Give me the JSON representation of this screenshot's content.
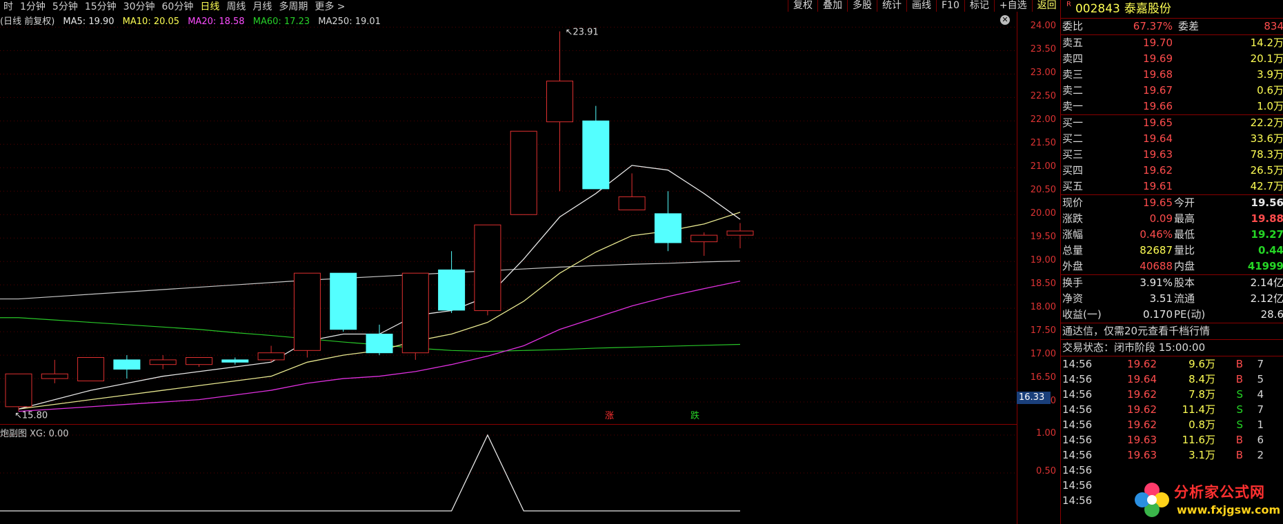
{
  "periods": [
    "时",
    "1分钟",
    "5分钟",
    "15分钟",
    "30分钟",
    "60分钟",
    "日线",
    "周线",
    "月线",
    "多周期",
    "更多 >"
  ],
  "active_period": "日线",
  "toolbar": [
    "复权",
    "叠加",
    "多股",
    "统计",
    "画线",
    "F10",
    "标记",
    "+自选",
    "返回"
  ],
  "legend": {
    "prefix": "(日线 前复权)",
    "ma5": "MA5: 19.90",
    "ma10": "MA10: 20.05",
    "ma20": "MA20: 18.58",
    "ma60": "MA60: 17.23",
    "ma250": "MA250: 19.01"
  },
  "colors": {
    "up": "#e03030",
    "down": "#54ffff",
    "ma5": "#e8e8e8",
    "ma10": "#e8e890",
    "ma20": "#e030e0",
    "ma60": "#28c828",
    "ma250": "#c8c8c8"
  },
  "price_ticks": [
    "24.00",
    "23.50",
    "23.00",
    "22.50",
    "22.00",
    "21.50",
    "21.00",
    "20.50",
    "20.00",
    "19.50",
    "19.00",
    "18.50",
    "18.00",
    "17.50",
    "17.00",
    "16.50",
    "16.00"
  ],
  "last_price_label": "16.33",
  "annotations": {
    "high": "23.91",
    "low": "15.80",
    "zhang": "涨",
    "die": "跌"
  },
  "candles": [
    {
      "o": 15.9,
      "c": 16.6,
      "h": 16.6,
      "l": 15.8
    },
    {
      "o": 16.5,
      "c": 16.6,
      "h": 16.9,
      "l": 16.4
    },
    {
      "o": 16.45,
      "c": 16.95,
      "h": 16.95,
      "l": 16.45
    },
    {
      "o": 16.9,
      "c": 16.7,
      "h": 17.0,
      "l": 16.5
    },
    {
      "o": 16.8,
      "c": 16.9,
      "h": 17.0,
      "l": 16.7
    },
    {
      "o": 16.8,
      "c": 16.95,
      "h": 16.95,
      "l": 16.75
    },
    {
      "o": 16.9,
      "c": 16.85,
      "h": 16.95,
      "l": 16.8
    },
    {
      "o": 16.9,
      "c": 17.05,
      "h": 17.2,
      "l": 16.85
    },
    {
      "o": 17.1,
      "c": 18.75,
      "h": 18.75,
      "l": 16.95
    },
    {
      "o": 18.75,
      "c": 17.55,
      "h": 18.75,
      "l": 17.5
    },
    {
      "o": 17.45,
      "c": 17.05,
      "h": 17.65,
      "l": 17.0
    },
    {
      "o": 17.05,
      "c": 18.75,
      "h": 18.75,
      "l": 16.9
    },
    {
      "o": 18.82,
      "c": 17.96,
      "h": 19.22,
      "l": 17.9
    },
    {
      "o": 17.95,
      "c": 19.78,
      "h": 19.78,
      "l": 17.85
    },
    {
      "o": 20.0,
      "c": 21.78,
      "h": 21.78,
      "l": 20.0
    },
    {
      "o": 21.98,
      "c": 22.85,
      "h": 23.91,
      "l": 20.5
    },
    {
      "o": 22.0,
      "c": 20.55,
      "h": 22.32,
      "l": 20.55
    },
    {
      "o": 20.1,
      "c": 20.38,
      "h": 20.88,
      "l": 20.1
    },
    {
      "o": 20.02,
      "c": 19.4,
      "h": 20.5,
      "l": 19.22
    },
    {
      "o": 19.42,
      "c": 19.56,
      "h": 19.62,
      "l": 19.12
    },
    {
      "o": 19.56,
      "c": 19.65,
      "h": 19.82,
      "l": 19.28
    }
  ],
  "ma5_line": [
    15.85,
    16.05,
    16.25,
    16.4,
    16.55,
    16.65,
    16.75,
    16.85,
    17.3,
    17.45,
    17.45,
    17.85,
    17.95,
    18.25,
    19.05,
    19.95,
    20.45,
    21.05,
    20.95,
    20.45,
    19.9
  ],
  "ma10_line": [
    15.85,
    15.95,
    16.05,
    16.15,
    16.25,
    16.35,
    16.45,
    16.55,
    16.85,
    17.0,
    17.1,
    17.3,
    17.45,
    17.7,
    18.15,
    18.75,
    19.2,
    19.55,
    19.65,
    19.8,
    20.05
  ],
  "ma20_line": [
    15.8,
    15.85,
    15.9,
    15.95,
    16.0,
    16.05,
    16.15,
    16.25,
    16.4,
    16.5,
    16.55,
    16.65,
    16.8,
    16.98,
    17.2,
    17.55,
    17.8,
    18.05,
    18.25,
    18.42,
    18.58
  ],
  "ma60_line": [
    17.8,
    17.75,
    17.7,
    17.65,
    17.6,
    17.55,
    17.48,
    17.42,
    17.35,
    17.28,
    17.22,
    17.15,
    17.1,
    17.08,
    17.1,
    17.12,
    17.15,
    17.17,
    17.19,
    17.21,
    17.23
  ],
  "ma250_line": [
    18.2,
    18.25,
    18.3,
    18.35,
    18.4,
    18.45,
    18.5,
    18.55,
    18.6,
    18.64,
    18.68,
    18.72,
    18.76,
    18.8,
    18.84,
    18.88,
    18.91,
    18.94,
    18.96,
    18.99,
    19.01
  ],
  "indicator": {
    "legend": "炮副图 XG: 0.00",
    "ticks": [
      "1.00",
      "0.50"
    ],
    "values": [
      0,
      0,
      0,
      0,
      0,
      0,
      0,
      0,
      0,
      0,
      0,
      0,
      0,
      1,
      0,
      0,
      0,
      0,
      0,
      0,
      0
    ]
  },
  "quote": {
    "code": "002843",
    "name": "泰嘉股份",
    "weibi_label": "委比",
    "weibi_val": "67.37%",
    "weicha_label": "委差",
    "weicha_val": "834",
    "asks": [
      {
        "label": "卖五",
        "price": "19.70",
        "vol": "14.2万"
      },
      {
        "label": "卖四",
        "price": "19.69",
        "vol": "20.1万"
      },
      {
        "label": "卖三",
        "price": "19.68",
        "vol": "3.9万"
      },
      {
        "label": "卖二",
        "price": "19.67",
        "vol": "0.6万"
      },
      {
        "label": "卖一",
        "price": "19.66",
        "vol": "1.0万"
      }
    ],
    "bids": [
      {
        "label": "买一",
        "price": "19.65",
        "vol": "22.2万"
      },
      {
        "label": "买二",
        "price": "19.64",
        "vol": "33.6万"
      },
      {
        "label": "买三",
        "price": "19.63",
        "vol": "78.3万"
      },
      {
        "label": "买四",
        "price": "19.62",
        "vol": "26.5万"
      },
      {
        "label": "买五",
        "price": "19.61",
        "vol": "42.7万"
      }
    ],
    "stats1": [
      {
        "l1": "现价",
        "v1": "19.65",
        "l2": "今开",
        "v2": "19.56",
        "c1": "red",
        "c2": "white"
      },
      {
        "l1": "涨跌",
        "v1": "0.09",
        "l2": "最高",
        "v2": "19.88",
        "c1": "red",
        "c2": "red"
      },
      {
        "l1": "涨幅",
        "v1": "0.46%",
        "l2": "最低",
        "v2": "19.27",
        "c1": "red",
        "c2": "green"
      },
      {
        "l1": "总量",
        "v1": "82687",
        "l2": "量比",
        "v2": "0.44",
        "c1": "yellow",
        "c2": "green"
      },
      {
        "l1": "外盘",
        "v1": "40688",
        "l2": "内盘",
        "v2": "41999",
        "c1": "red",
        "c2": "green"
      }
    ],
    "stats2": [
      {
        "l1": "换手",
        "v1": "3.91%",
        "l2": "股本",
        "v2": "2.14亿"
      },
      {
        "l1": "净资",
        "v1": "3.51",
        "l2": "流通",
        "v2": "2.12亿"
      },
      {
        "l1": "收益(一)",
        "v1": "0.170",
        "l2": "PE(动)",
        "v2": "28.6"
      }
    ],
    "promo": "通达信，仅需20元查看千档行情",
    "status": "交易状态：闭市阶段 15:00:00",
    "ticks": [
      {
        "t": "14:56",
        "p": "19.62",
        "v": "9.6万",
        "f": "B",
        "n": "7"
      },
      {
        "t": "14:56",
        "p": "19.64",
        "v": "8.4万",
        "f": "B",
        "n": "5"
      },
      {
        "t": "14:56",
        "p": "19.62",
        "v": "7.8万",
        "f": "S",
        "n": "4"
      },
      {
        "t": "14:56",
        "p": "19.62",
        "v": "11.4万",
        "f": "S",
        "n": "7"
      },
      {
        "t": "14:56",
        "p": "19.62",
        "v": "0.8万",
        "f": "S",
        "n": "1"
      },
      {
        "t": "14:56",
        "p": "19.63",
        "v": "11.6万",
        "f": "B",
        "n": "6"
      },
      {
        "t": "14:56",
        "p": "19.63",
        "v": "3.1万",
        "f": "B",
        "n": "2"
      },
      {
        "t": "14:56",
        "p": "",
        "v": "",
        "f": "",
        "n": ""
      },
      {
        "t": "14:56",
        "p": "",
        "v": "",
        "f": "",
        "n": ""
      },
      {
        "t": "14:56",
        "p": "",
        "v": "",
        "f": "",
        "n": ""
      }
    ]
  },
  "watermark": {
    "brand": "分析家公式网",
    "url": "www.fxjgsw.com"
  }
}
